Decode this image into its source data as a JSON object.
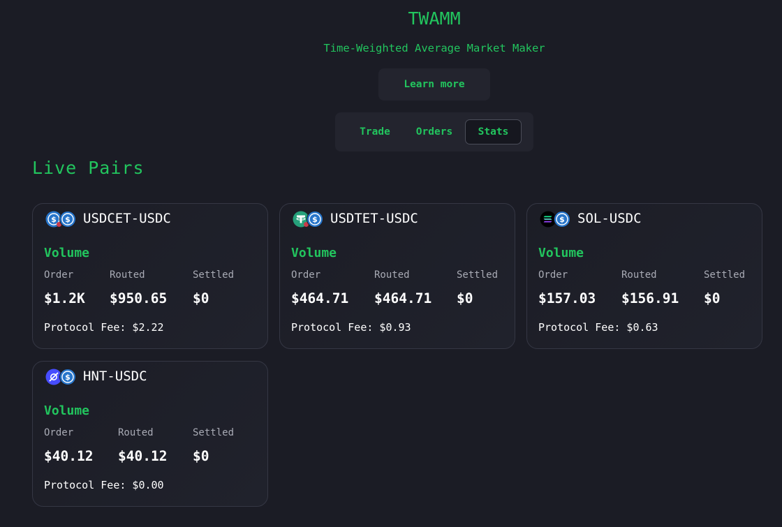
{
  "app": {
    "title": "TWAMM",
    "subtitle": "Time-Weighted Average Market Maker",
    "learn_more": "Learn more"
  },
  "tabs": [
    {
      "label": "Trade",
      "active": false
    },
    {
      "label": "Orders",
      "active": false
    },
    {
      "label": "Stats",
      "active": true
    }
  ],
  "section": {
    "title": "Live Pairs"
  },
  "labels": {
    "volume": "Volume",
    "order": "Order",
    "routed": "Routed",
    "settled": "Settled"
  },
  "pairs": [
    {
      "name": "USDCET-USDC",
      "icons": [
        "usdc-et-coin-icon",
        "usdc-coin-icon"
      ],
      "order": "$1.2K",
      "routed": "$950.65",
      "settled": "$0",
      "fee": "Protocol Fee: $2.22"
    },
    {
      "name": "USDTET-USDC",
      "icons": [
        "usdt-et-coin-icon",
        "usdc-coin-icon"
      ],
      "order": "$464.71",
      "routed": "$464.71",
      "settled": "$0",
      "fee": "Protocol Fee: $0.93"
    },
    {
      "name": "SOL-USDC",
      "icons": [
        "sol-coin-icon",
        "usdc-coin-icon"
      ],
      "order": "$157.03",
      "routed": "$156.91",
      "settled": "$0",
      "fee": "Protocol Fee: $0.63"
    },
    {
      "name": "HNT-USDC",
      "icons": [
        "hnt-coin-icon",
        "usdc-coin-icon"
      ],
      "order": "$40.12",
      "routed": "$40.12",
      "settled": "$0",
      "fee": "Protocol Fee: $0.00"
    }
  ],
  "colors": {
    "background": "#1b1c25",
    "accent": "#22c55e",
    "usdc": "#2775ca",
    "usdt": "#26a17b",
    "sol": "#14f195",
    "hnt": "#474dff"
  }
}
